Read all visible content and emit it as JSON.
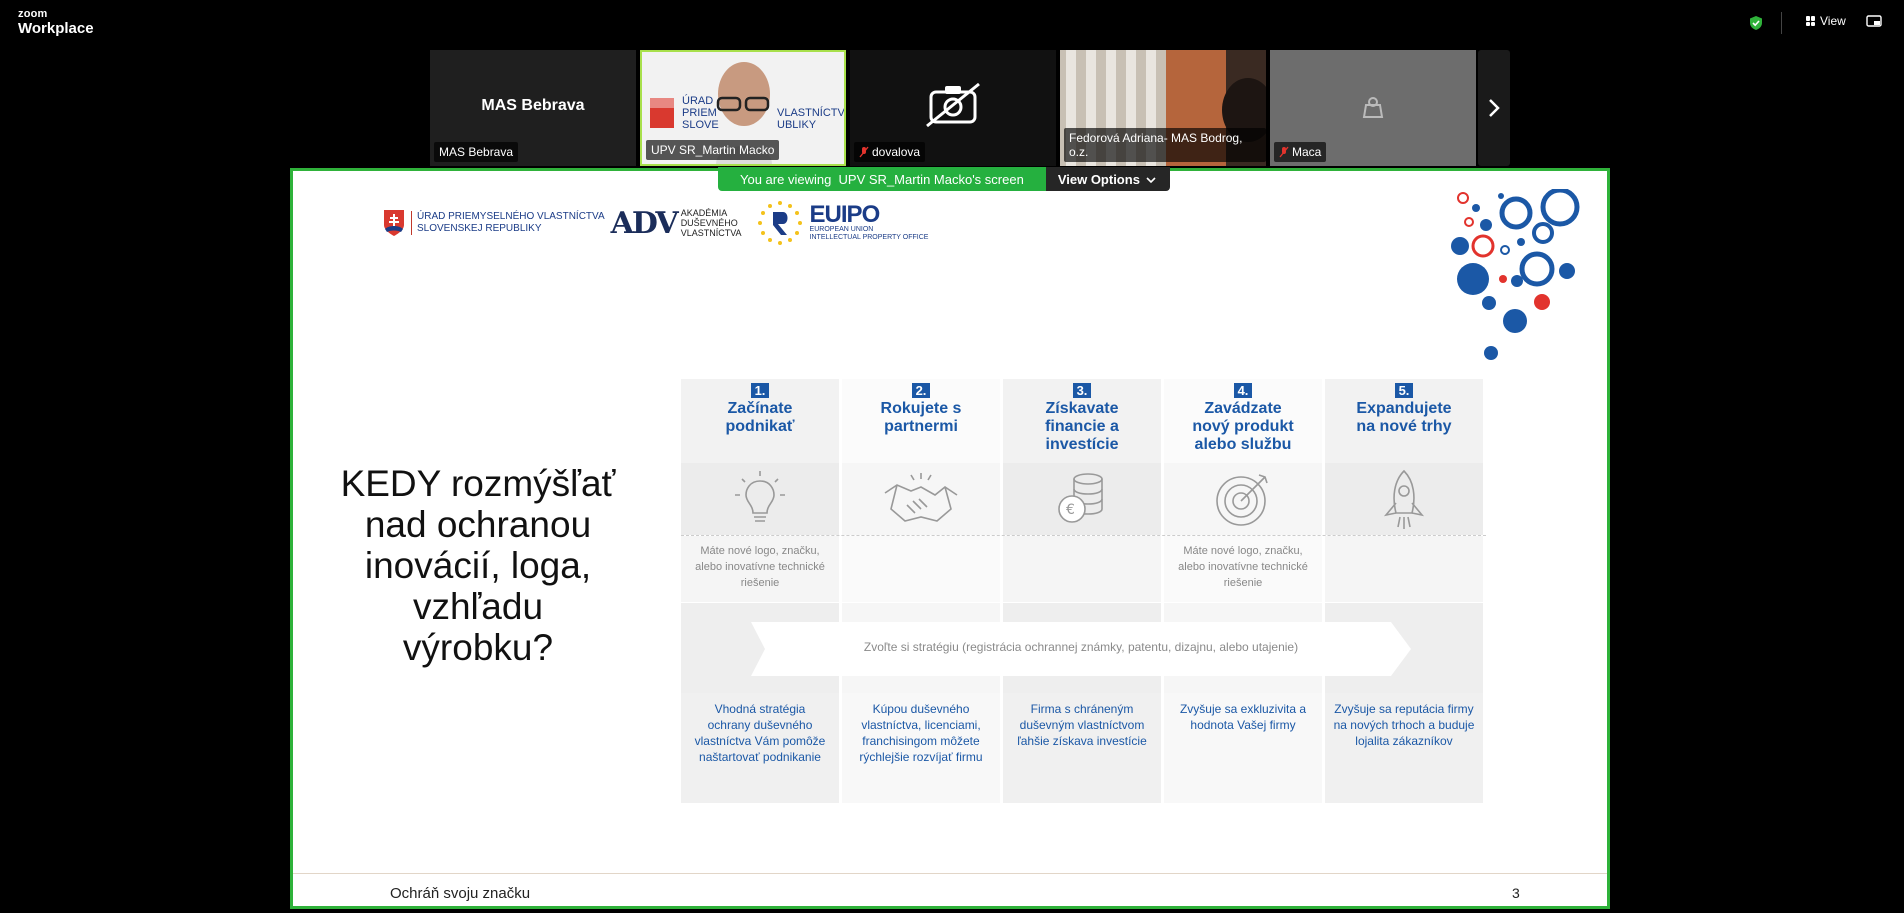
{
  "app": {
    "logo_small": "zoom",
    "logo_big": "Workplace",
    "view_label": "View"
  },
  "colors": {
    "accent_green": "#25b03f",
    "border_green": "#2fb23a",
    "slide_blue": "#1b58a6",
    "brand_red": "#e2332d"
  },
  "participants": [
    {
      "name": "MAS Bebrava",
      "display": "MAS Bebrava",
      "muted": false
    },
    {
      "name": "UPV SR_Martin Macko",
      "muted": false
    },
    {
      "name": "dovalova",
      "muted": true
    },
    {
      "name": "Fedorová Adriana- MAS Bodrog, o.z.",
      "muted": false
    },
    {
      "name": "Maca",
      "muted": true
    }
  ],
  "banner": {
    "viewing_prefix": "You are viewing",
    "viewing_name": "UPV SR_Martin Macko's screen",
    "view_options": "View Options"
  },
  "slide": {
    "logos": {
      "upv_line1": "ÚRAD PRIEMYSELNÉHO VLASTNÍCTVA",
      "upv_line2": "SLOVENSKEJ REPUBLIKY",
      "adv_mark": "ADV",
      "adv_line1": "AKADÉMIA",
      "adv_line2": "DUŠEVNÉHO",
      "adv_line3": "VLASTNÍCTVA",
      "euipo_name": "EUIPO",
      "euipo_line1": "EUROPEAN UNION",
      "euipo_line2": "INTELLECTUAL PROPERTY OFFICE"
    },
    "title": "KEDY rozmýšľať nad ochranou inovácií, loga, vzhľadu výrobku?",
    "columns": [
      {
        "num": "1.",
        "head": "Začínate podnikať",
        "desc": "Máte nové logo, značku, alebo inovatívne technické riešenie",
        "bottom": "Vhodná stratégia ochrany duševného vlastníctva Vám pomôže naštartovať podnikanie"
      },
      {
        "num": "2.",
        "head": "Rokujete s partnermi",
        "desc": "",
        "bottom": "Kúpou duševného vlastníctva, licenciami, franchisingom môžete rýchlejšie rozvíjať firmu"
      },
      {
        "num": "3.",
        "head": "Získavate financie a investície",
        "desc": "",
        "bottom": "Firma s chráneným duševným vlastníctvom ľahšie získava investície"
      },
      {
        "num": "4.",
        "head": "Zavádzate nový produkt alebo službu",
        "desc": "Máte nové logo, značku, alebo inovatívne technické riešenie",
        "bottom": "Zvyšuje sa exkluzivita a hodnota Vašej firmy"
      },
      {
        "num": "5.",
        "head": "Expandujete na nové trhy",
        "desc": "",
        "bottom": "Zvyšuje sa reputácia firmy na nových trhoch a buduje lojalita zákazníkov"
      }
    ],
    "icons": [
      "lightbulb-icon",
      "handshake-icon",
      "coins-icon",
      "target-icon",
      "rocket-icon"
    ],
    "strategy": "Zvoľte si stratégiu (registrácia ochrannej známky, patentu, dizajnu, alebo utajenie)",
    "footer_left": "Ochráň svoju značku",
    "page_number": "3"
  }
}
